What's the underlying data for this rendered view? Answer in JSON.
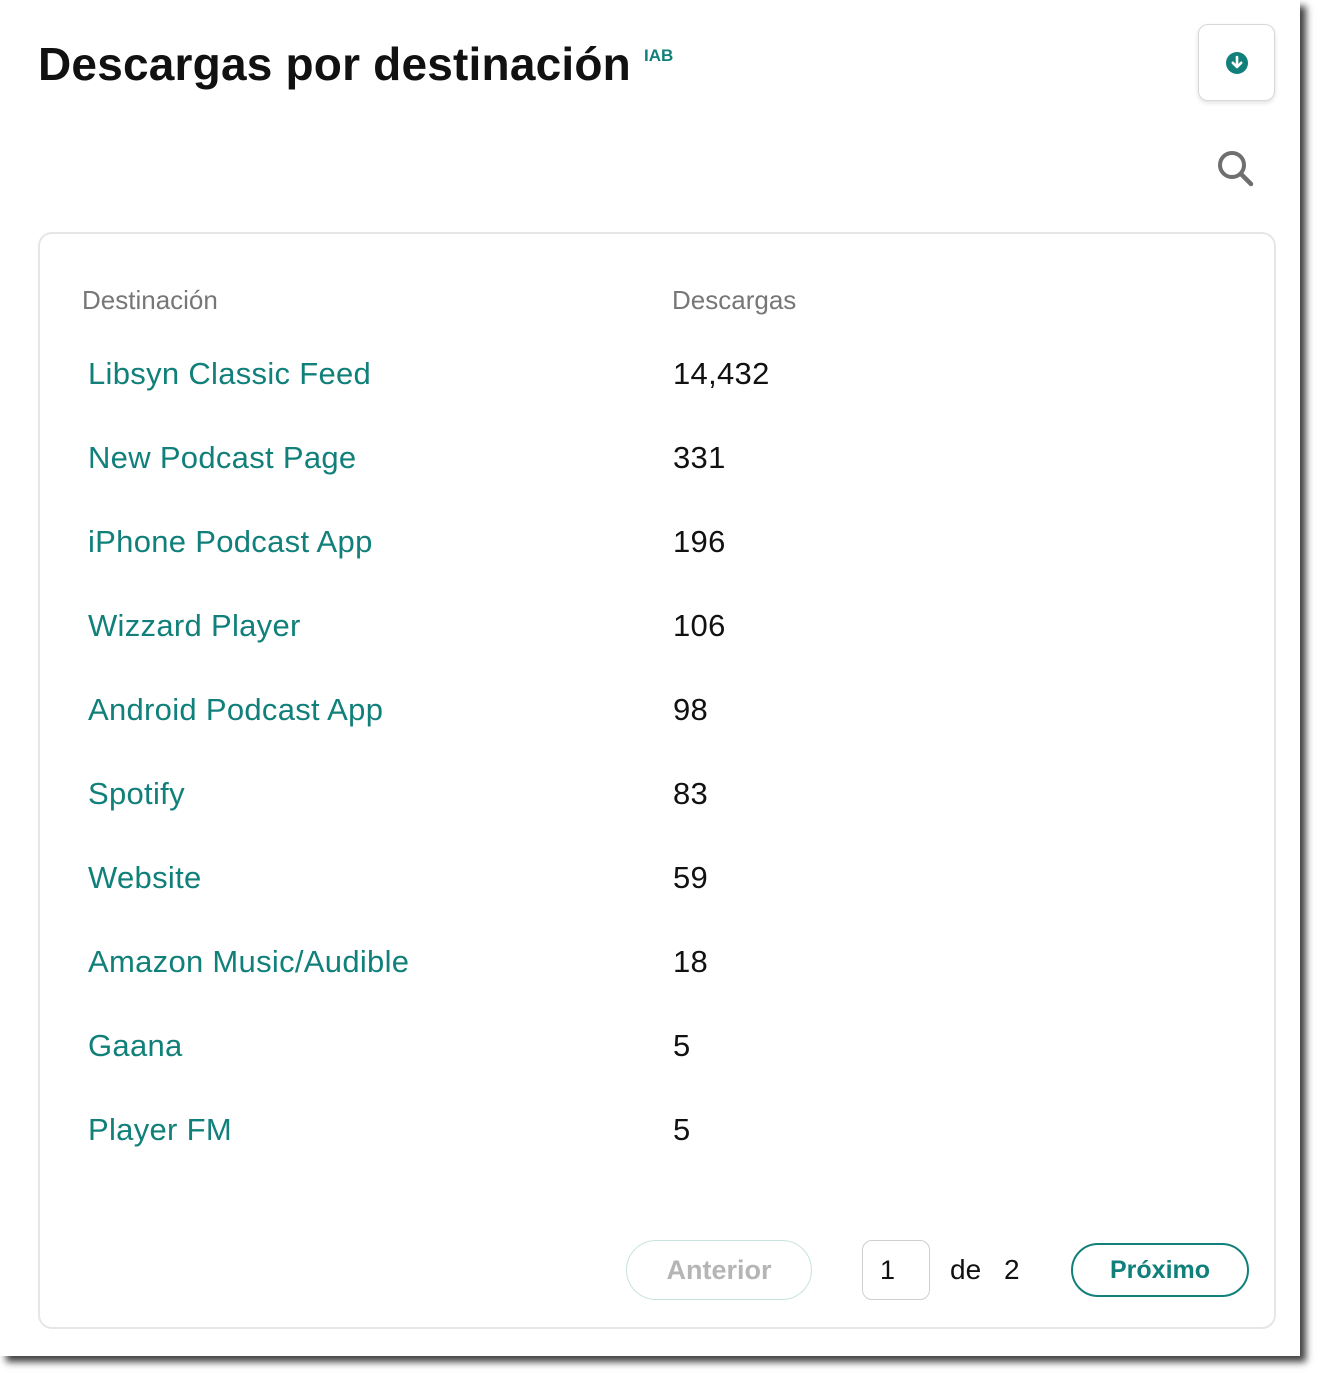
{
  "header": {
    "title": "Descargas por destinación",
    "badge": "IAB"
  },
  "icons": {
    "download": "download-circle-icon",
    "search": "search-icon"
  },
  "colors": {
    "accent": "#11807a",
    "muted_text": "#777777",
    "disabled_text": "#b5b5b5"
  },
  "table": {
    "columns": {
      "destination": "Destinación",
      "downloads": "Descargas"
    },
    "rows": [
      {
        "destination": "Libsyn Classic Feed",
        "downloads": "14,432"
      },
      {
        "destination": "New Podcast Page",
        "downloads": "331"
      },
      {
        "destination": "iPhone Podcast App",
        "downloads": "196"
      },
      {
        "destination": "Wizzard Player",
        "downloads": "106"
      },
      {
        "destination": "Android Podcast App",
        "downloads": "98"
      },
      {
        "destination": "Spotify",
        "downloads": "83"
      },
      {
        "destination": "Website",
        "downloads": "59"
      },
      {
        "destination": "Amazon Music/Audible",
        "downloads": "18"
      },
      {
        "destination": "Gaana",
        "downloads": "5"
      },
      {
        "destination": "Player FM",
        "downloads": "5"
      }
    ]
  },
  "pagination": {
    "prev_label": "Anterior",
    "current_page": "1",
    "of_label": "de",
    "total_pages": "2",
    "next_label": "Próximo"
  }
}
